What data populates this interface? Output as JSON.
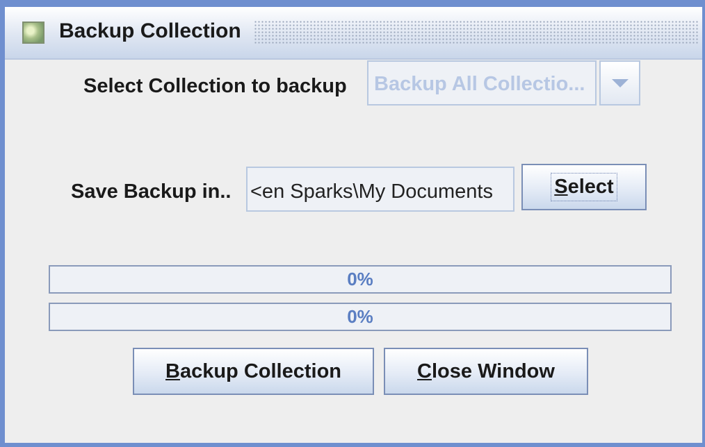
{
  "window": {
    "title": "Backup Collection",
    "icon": "collection-app-icon"
  },
  "collection": {
    "label": "Select Collection to backup",
    "selected": "Backup All Collectio...",
    "arrow_icon": "chevron-down-icon"
  },
  "backup_location": {
    "label": "Save Backup in..",
    "value": "<en Sparks\\My Documents",
    "select_button": {
      "mnemonic": "S",
      "rest": "elect"
    }
  },
  "progress": [
    {
      "text": "0%",
      "value": 0
    },
    {
      "text": "0%",
      "value": 0
    }
  ],
  "actions": {
    "backup": {
      "mnemonic": "B",
      "rest": "ackup Collection"
    },
    "close": {
      "mnemonic": "C",
      "rest": "lose Window"
    }
  },
  "colors": {
    "frame_border": "#6f8fcf",
    "disabled_text": "#b7c7e4",
    "progress_text": "#5a7ec2"
  }
}
